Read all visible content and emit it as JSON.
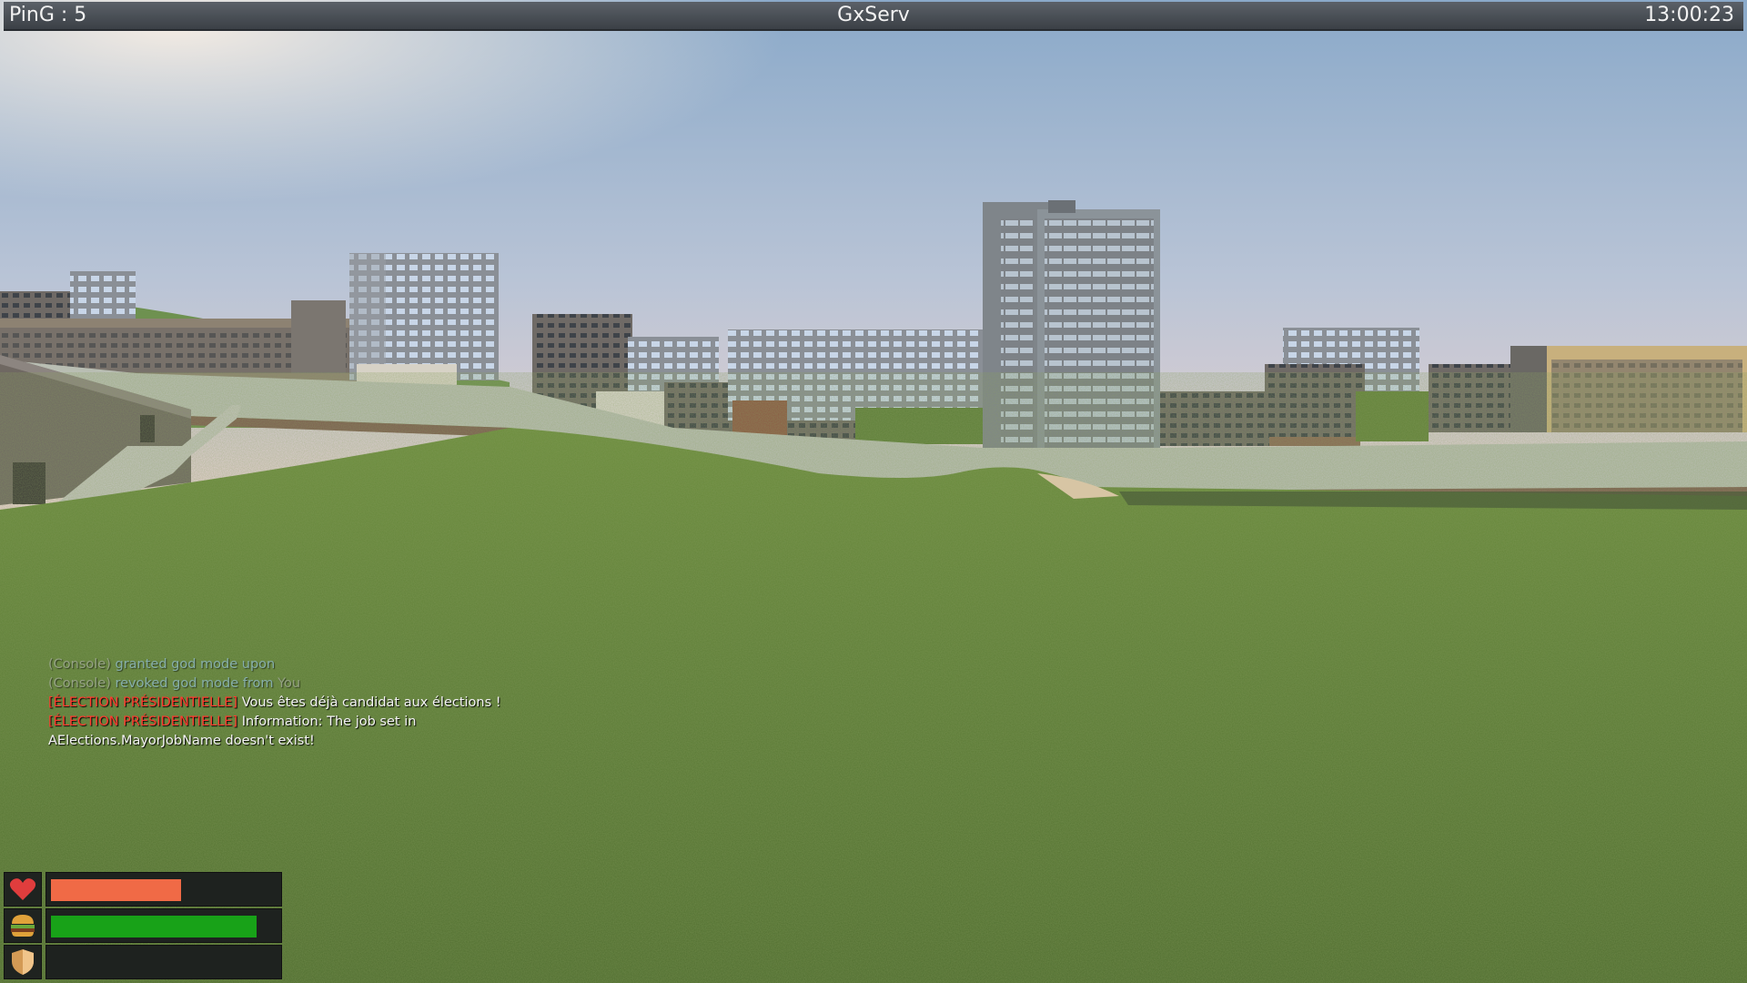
{
  "header": {
    "ping": "PinG : 5",
    "server_name": "GxServ",
    "clock": "13:00:23"
  },
  "chat": {
    "lines": [
      {
        "prefix": "(Console)",
        "text": "granted god mode upon",
        "faded": true
      },
      {
        "prefix": "(Console)",
        "text": "revoked god mode from",
        "suffix": "You",
        "faded": true
      },
      {
        "prefix": "[ÉLECTION PRÉSIDENTIELLE]",
        "text": "Vous êtes déjà candidat aux élections !"
      },
      {
        "prefix": "[ÉLECTION PRÉSIDENTIELLE]",
        "text": "Information: The job set in"
      },
      {
        "text": "AElections.MayorJobName doesn't exist!"
      }
    ]
  },
  "hud": {
    "health": 0.6,
    "food": 0.95,
    "armor": 0,
    "colors": {
      "health": "#f06a46",
      "food": "#18a218"
    },
    "icons": [
      "heart-icon",
      "burger-icon",
      "shield-icon"
    ]
  }
}
